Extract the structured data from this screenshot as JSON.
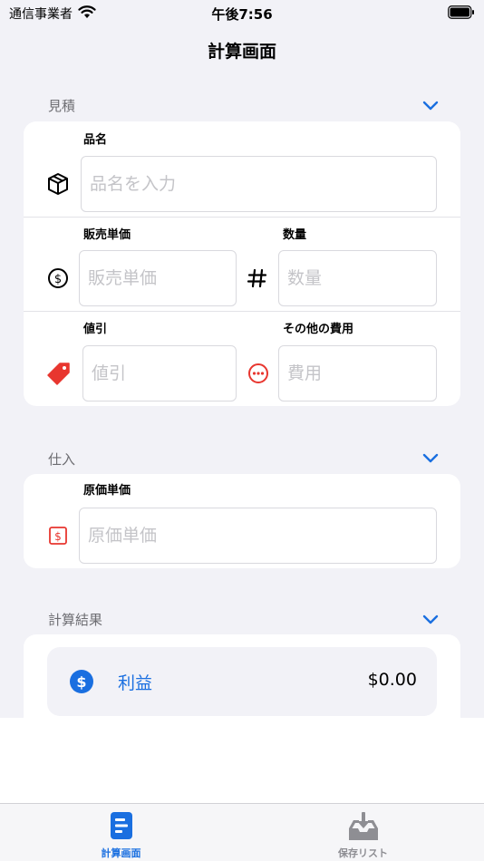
{
  "status_bar": {
    "carrier": "通信事業者",
    "time": "午後7:56"
  },
  "nav": {
    "title": "計算画面"
  },
  "estimate": {
    "header": "見積",
    "item_name": {
      "label": "品名",
      "placeholder": "品名を入力",
      "icon": "box-icon"
    },
    "unit_price": {
      "label": "販売単価",
      "placeholder": "販売単価",
      "icon": "dollar-circle-icon"
    },
    "quantity": {
      "label": "数量",
      "placeholder": "数量",
      "icon": "hash-icon"
    },
    "discount": {
      "label": "値引",
      "placeholder": "値引",
      "icon": "tag-icon"
    },
    "other_cost": {
      "label": "その他の費用",
      "placeholder": "費用",
      "icon": "ellipsis-circle-icon"
    }
  },
  "purchase": {
    "header": "仕入",
    "cost_price": {
      "label": "原価単価",
      "placeholder": "原価単価",
      "icon": "dollar-square-icon"
    }
  },
  "results": {
    "header": "計算結果",
    "profit": {
      "label": "利益",
      "value": "$0.00",
      "icon": "dollar-circle-fill-icon"
    }
  },
  "tabs": [
    {
      "label": "計算画面",
      "icon": "calculator-doc-icon",
      "active": true
    },
    {
      "label": "保存リスト",
      "icon": "tray-download-icon",
      "active": false
    }
  ],
  "colors": {
    "accent": "#1a6fe0",
    "red": "#e8362f",
    "background": "#f2f2f7",
    "inactive": "#8e8e93"
  }
}
